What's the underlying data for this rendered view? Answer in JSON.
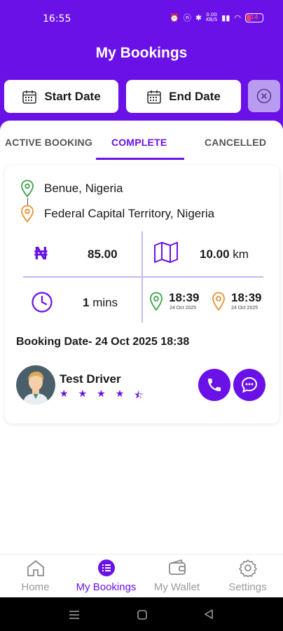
{
  "status_bar": {
    "time": "16:55",
    "battery": "14",
    "network": "0.00",
    "network_unit": "KB/S"
  },
  "header": {
    "title": "My Bookings"
  },
  "filters": {
    "start_label": "Start Date",
    "end_label": "End Date"
  },
  "tabs": [
    {
      "label": "ACTIVE BOOKING"
    },
    {
      "label": "COMPLETE"
    },
    {
      "label": "CANCELLED"
    }
  ],
  "booking": {
    "pickup": "Benue, Nigeria",
    "dropoff": "Federal Capital Territory, Nigeria",
    "currency_symbol": "₦",
    "amount": "85.00",
    "distance": "10.00",
    "distance_unit": "km",
    "duration": "1",
    "duration_unit": "mins",
    "start_time": "18:39",
    "start_date": "24 Oct 2025",
    "end_time": "18:39",
    "end_date": "24 Oct 2025",
    "booking_date": "Booking Date- 24 Oct 2025 18:38",
    "driver_name": "Test Driver",
    "rating": 4.5
  },
  "nav": [
    {
      "label": "Home",
      "icon": "home-icon"
    },
    {
      "label": "My Bookings",
      "icon": "list-icon"
    },
    {
      "label": "My Wallet",
      "icon": "wallet-icon"
    },
    {
      "label": "Settings",
      "icon": "gear-icon"
    }
  ],
  "colors": {
    "primary": "#6a11e8",
    "green": "#3aa346",
    "orange": "#e8912e",
    "divider": "#c9b8ee"
  }
}
